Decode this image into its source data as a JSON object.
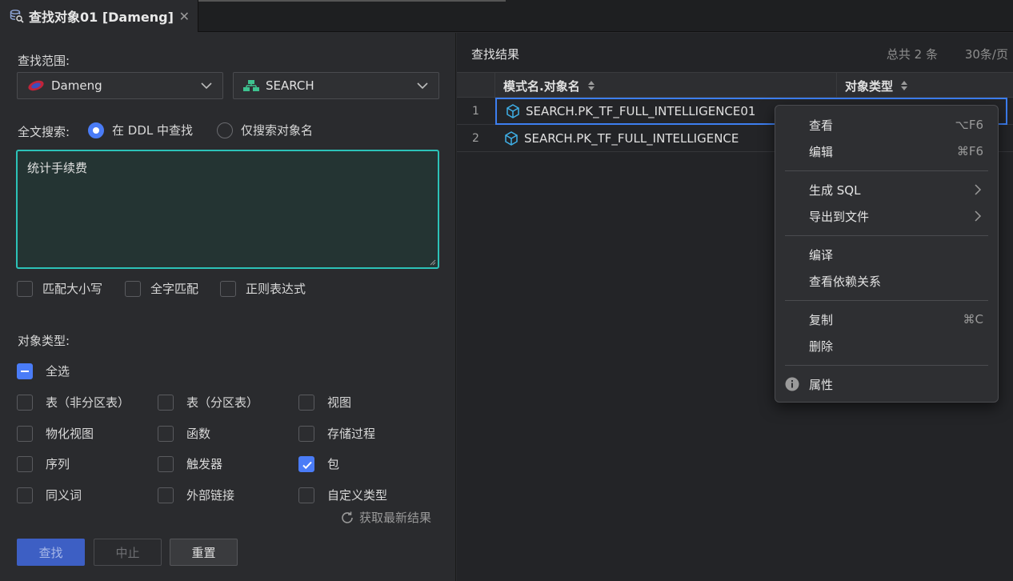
{
  "tab": {
    "title": "查找对象01 [Dameng]",
    "close": "✕"
  },
  "search_form": {
    "scope_label": "查找范围:",
    "datasource": "Dameng",
    "schema": "SEARCH",
    "fulltext_label": "全文搜索:",
    "radio_ddl": "在 DDL 中查找",
    "radio_name": "仅搜索对象名",
    "query_text": "统计手续费",
    "options": [
      "匹配大小写",
      "全字匹配",
      "正则表达式"
    ],
    "type_label": "对象类型:",
    "select_all": "全选",
    "types": [
      {
        "label": "表（非分区表）",
        "checked": false
      },
      {
        "label": "表（分区表）",
        "checked": false
      },
      {
        "label": "视图",
        "checked": false
      },
      {
        "label": "物化视图",
        "checked": false
      },
      {
        "label": "函数",
        "checked": false
      },
      {
        "label": "存储过程",
        "checked": false
      },
      {
        "label": "序列",
        "checked": false
      },
      {
        "label": "触发器",
        "checked": false
      },
      {
        "label": "包",
        "checked": true
      },
      {
        "label": "同义词",
        "checked": false
      },
      {
        "label": "外部链接",
        "checked": false
      },
      {
        "label": "自定义类型",
        "checked": false
      }
    ],
    "btn_search": "查找",
    "btn_stop": "中止",
    "btn_reset": "重置",
    "refresh": "获取最新结果"
  },
  "results": {
    "title": "查找结果",
    "total": "总共 2 条",
    "page_size": "30条/页",
    "col_name": "模式名.对象名",
    "col_type": "对象类型",
    "rows": [
      {
        "num": "1",
        "name": "SEARCH.PK_TF_FULL_INTELLIGENCE01"
      },
      {
        "num": "2",
        "name": "SEARCH.PK_TF_FULL_INTELLIGENCE"
      }
    ]
  },
  "context_menu": {
    "view": "查看",
    "view_key": "⌥F6",
    "edit": "编辑",
    "edit_key": "⌘F6",
    "gen_sql": "生成 SQL",
    "export": "导出到文件",
    "compile": "编译",
    "deps": "查看依赖关系",
    "copy": "复制",
    "copy_key": "⌘C",
    "delete": "删除",
    "props": "属性"
  },
  "colors": {
    "accent": "#4a7cf7",
    "textarea_border": "#2cc2b8",
    "selection": "#3d7ef0"
  }
}
